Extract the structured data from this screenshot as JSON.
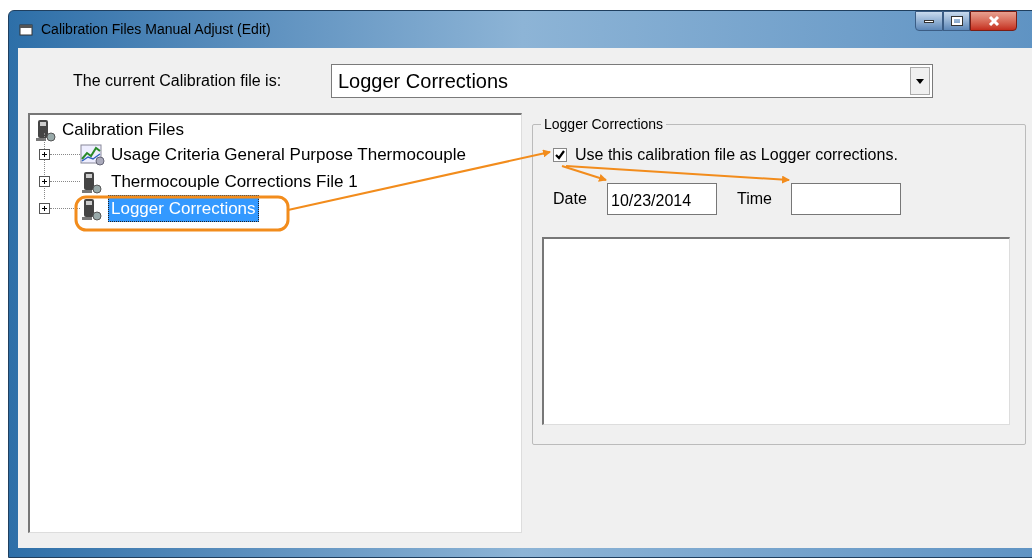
{
  "window": {
    "title": "Calibration Files Manual Adjust (Edit)"
  },
  "current_file": {
    "label": "The current Calibration file is:",
    "value": "Logger Corrections"
  },
  "tree": {
    "root": {
      "label": "Calibration Files",
      "children": [
        {
          "label": "Usage Criteria General Purpose Thermocouple",
          "kind": "chart",
          "expanded": false,
          "selected": false
        },
        {
          "label": "Thermocouple Corrections File 1",
          "kind": "logger",
          "expanded": false,
          "selected": false
        },
        {
          "label": "Logger Corrections",
          "kind": "logger",
          "expanded": false,
          "selected": true
        }
      ]
    }
  },
  "group": {
    "title": "Logger Corrections",
    "checkbox": {
      "label": "Use this calibration file as Logger corrections.",
      "checked": true
    },
    "date": {
      "label": "Date",
      "value": "10/23/2014"
    },
    "time": {
      "label": "Time"
    }
  }
}
